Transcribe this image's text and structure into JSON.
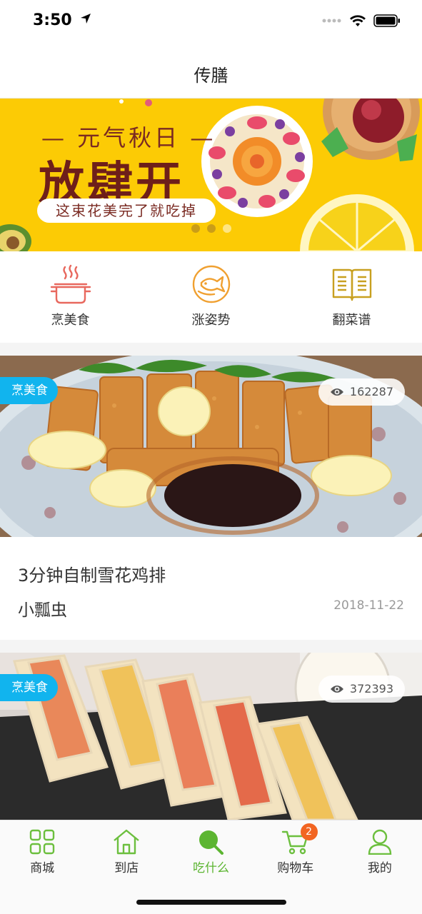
{
  "status_bar": {
    "time": "3:50"
  },
  "nav": {
    "title": "传膳"
  },
  "banner": {
    "subtitle": "— 元气秋日 —",
    "headline": "放肆开",
    "caption": "这束花美完了就吃掉",
    "active_slide": 1,
    "slide_count": 3
  },
  "categories": [
    {
      "label": "烹美食",
      "icon": "cooking-pot-icon",
      "color": "#e8685e"
    },
    {
      "label": "涨姿势",
      "icon": "fish-icon",
      "color": "#f0a030"
    },
    {
      "label": "翻菜谱",
      "icon": "recipe-book-icon",
      "color": "#c8a020"
    }
  ],
  "cards": [
    {
      "tag": "烹美食",
      "views": "162287",
      "title": "3分钟自制雪花鸡排",
      "author": "小瓢虫",
      "date": "2018-11-22"
    },
    {
      "tag": "烹美食",
      "views": "372393"
    }
  ],
  "tab_bar": {
    "items": [
      {
        "label": "商城",
        "icon": "grid-icon"
      },
      {
        "label": "到店",
        "icon": "store-icon"
      },
      {
        "label": "吃什么",
        "icon": "search-icon",
        "active": true
      },
      {
        "label": "购物车",
        "icon": "cart-icon",
        "badge": "2"
      },
      {
        "label": "我的",
        "icon": "user-icon"
      }
    ]
  },
  "colors": {
    "accent": "#5cb531",
    "tag": "#11b4ee",
    "badge": "#f26522",
    "banner": "#fccb05"
  }
}
